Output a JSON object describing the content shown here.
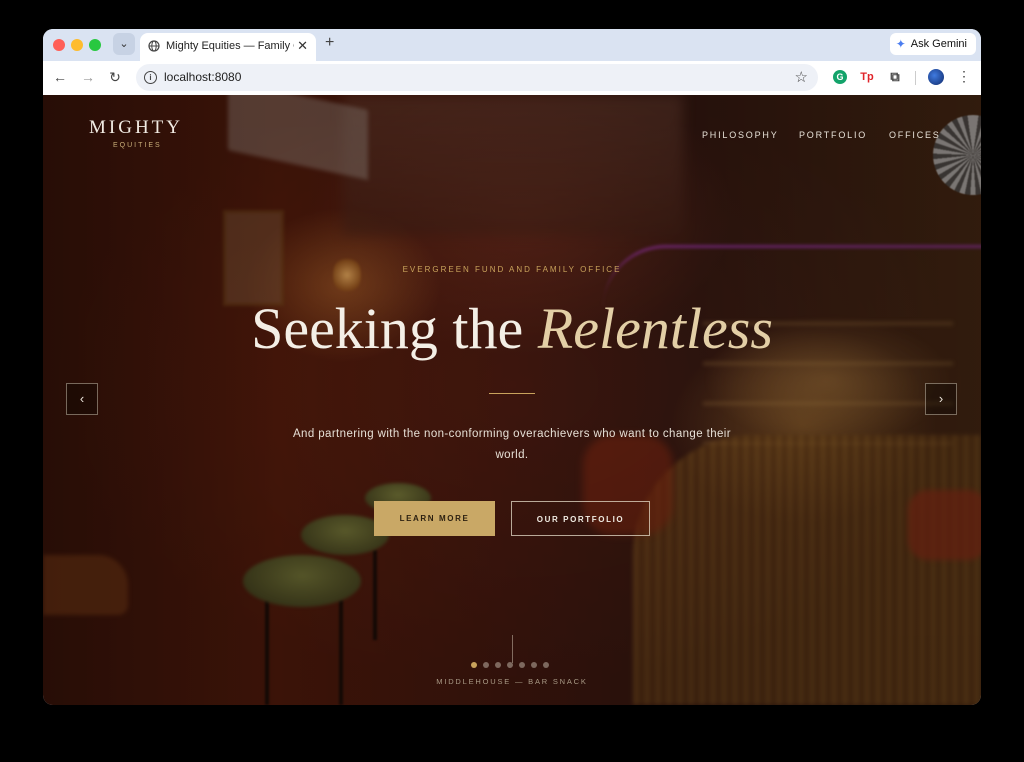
{
  "browser": {
    "tab_title": "Mighty Equities — Family Office",
    "new_tab_label": "+",
    "ask_gemini": "Ask Gemini",
    "url": "localhost:8080",
    "ext_tp": "Tp"
  },
  "site": {
    "logo": "MIGHTY",
    "logo_sub": "EQUITIES",
    "nav": [
      "PHILOSOPHY",
      "PORTFOLIO",
      "OFFICES"
    ]
  },
  "hero": {
    "eyebrow": "EVERGREEN FUND AND FAMILY OFFICE",
    "headline_plain": "Seeking the ",
    "headline_em": "Relentless",
    "lead": "And partnering with the non-conforming overachievers who want to change their world.",
    "primary_cta": "LEARN MORE",
    "secondary_cta": "OUR PORTFOLIO",
    "prev_arrow": "‹",
    "next_arrow": "›",
    "slide_count": 7,
    "active_slide": 1,
    "caption": "MIDDLEHOUSE — BAR SNACK"
  },
  "colors": {
    "accent_gold": "#c9a866",
    "headline_italic": "#e3cfa6"
  }
}
